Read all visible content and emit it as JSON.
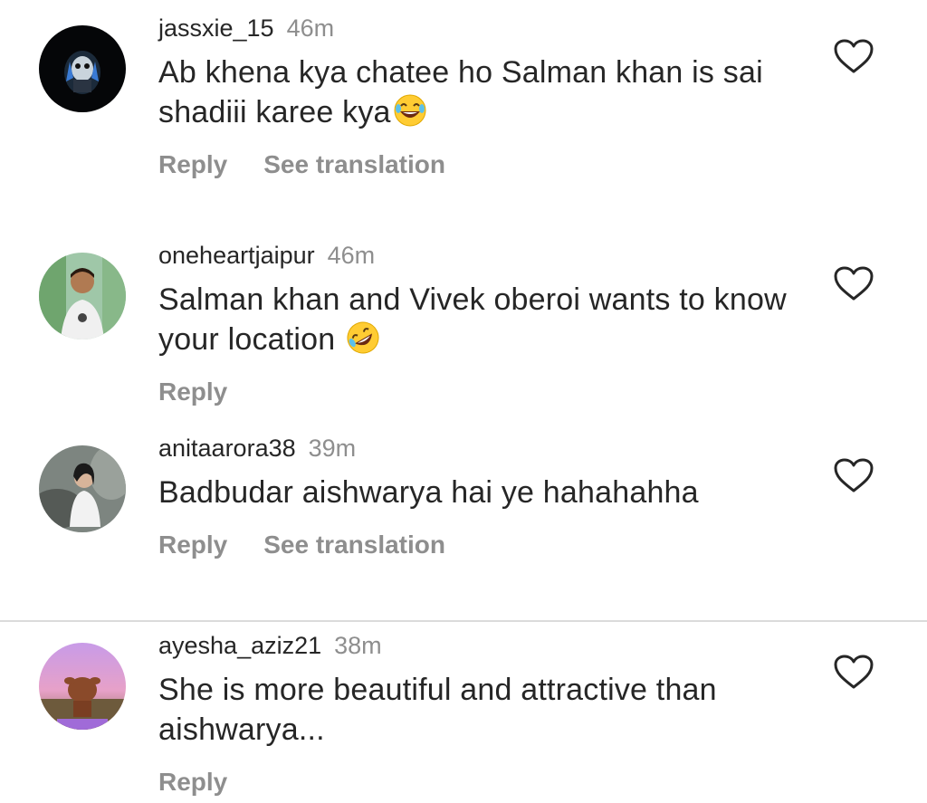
{
  "comments": [
    {
      "username": "jassxie_15",
      "time": "46m",
      "text": "Ab khena kya chatee ho Salman khan is sai shadiii karee kya",
      "emoji_icon": "face-with-tears-of-joy",
      "actions": [
        "Reply",
        "See translation"
      ]
    },
    {
      "username": "oneheartjaipur",
      "time": "46m",
      "text": "Salman khan and Vivek oberoi wants to know your location",
      "emoji_icon": "rolling-on-the-floor-laughing",
      "actions": [
        "Reply"
      ]
    },
    {
      "username": "anitaarora38",
      "time": "39m",
      "text": "Badbudar aishwarya hai ye hahahahha",
      "actions": [
        "Reply",
        "See translation"
      ]
    },
    {
      "username": "ayesha_aziz21",
      "time": "38m",
      "text": "She is more beautiful and attractive than aishwarya...",
      "actions": [
        "Reply"
      ]
    }
  ],
  "icons": {
    "like": "heart-outline-icon"
  },
  "colors": {
    "text": "#262626",
    "secondary": "#8e8e8e",
    "divider": "#dbdbdb"
  }
}
